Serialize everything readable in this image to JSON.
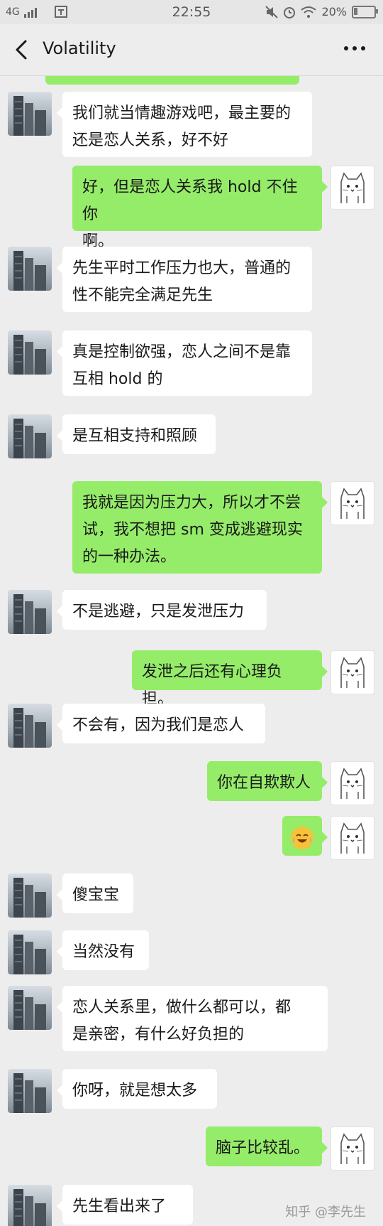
{
  "status_bar": {
    "network": "4G",
    "time": "22:55",
    "battery": "20%",
    "battery_level": 0.2
  },
  "header": {
    "title": "Volatility"
  },
  "messages": [
    {
      "side": "in",
      "text": "我们就当情趣游戏吧，最主要的\n还是恋人关系，好不好"
    },
    {
      "side": "out",
      "text": "好，但是恋人关系我 hold 不住你\n啊。"
    },
    {
      "side": "in",
      "text": "先生平时工作压力也大，普通的\n性不能完全满足先生"
    },
    {
      "side": "in",
      "text": "真是控制欲强，恋人之间不是靠\n互相 hold 的"
    },
    {
      "side": "in",
      "text": "是互相支持和照顾"
    },
    {
      "side": "out",
      "text": "我就是因为压力大，所以才不尝\n试，我不想把 sm 变成逃避现实\n的一种办法。"
    },
    {
      "side": "in",
      "text": "不是逃避，只是发泄压力"
    },
    {
      "side": "out",
      "text": "发泄之后还有心理负担。"
    },
    {
      "side": "in",
      "text": "不会有，因为我们是恋人"
    },
    {
      "side": "out",
      "text": "你在自欺欺人"
    },
    {
      "side": "out",
      "text": "",
      "emoji": "laughing-crying-emoji"
    },
    {
      "side": "in",
      "text": "傻宝宝"
    },
    {
      "side": "in",
      "text": "当然没有"
    },
    {
      "side": "in",
      "text": "恋人关系里，做什么都可以，都\n是亲密，有什么好负担的"
    },
    {
      "side": "in",
      "text": "你呀，就是想太多"
    },
    {
      "side": "out",
      "text": "脑子比较乱。"
    },
    {
      "side": "in",
      "text": "先生看出来了"
    }
  ],
  "watermark": "知乎 @李先生",
  "colors": {
    "background": "#ededed",
    "incoming_bubble": "#ffffff",
    "outgoing_bubble": "#95ec69"
  }
}
